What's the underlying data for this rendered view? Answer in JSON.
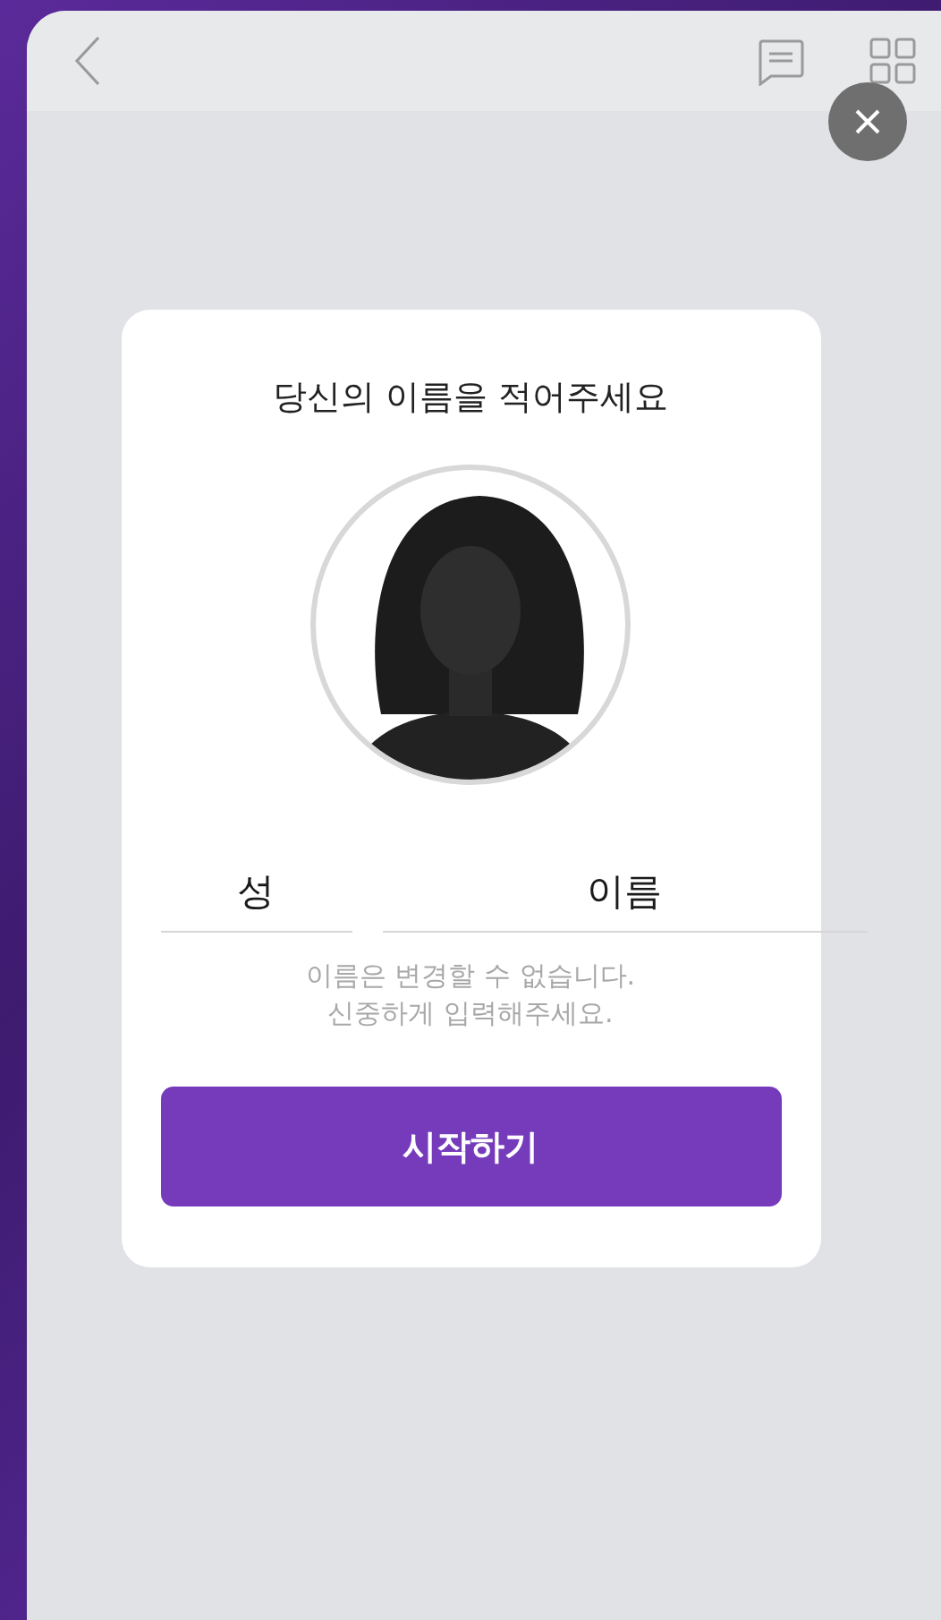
{
  "dialog": {
    "title": "당신의 이름을 적어주세요",
    "fields": [
      {
        "placeholder": "성"
      },
      {
        "placeholder": "이름"
      }
    ],
    "notice": [
      "이름은 변경할 수 없습니다.",
      "신중하게 입력해주세요."
    ],
    "button": "시작하기"
  }
}
